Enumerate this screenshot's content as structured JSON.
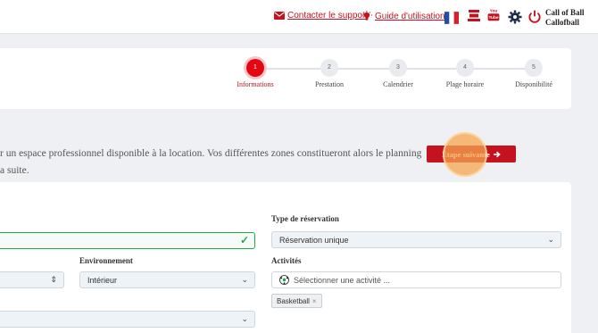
{
  "topbar": {
    "support_link": "Contacter le support",
    "guide_link": "Guide d'utilisation",
    "user": {
      "name": "Call of Ball",
      "handle": "Callofball"
    },
    "icons": [
      "envelope-icon",
      "lightbulb-icon",
      "french-flag-icon",
      "store-icon",
      "youtube-icon",
      "gear-icon",
      "power-icon"
    ],
    "colors": {
      "accent": "#c4121f"
    }
  },
  "stepper": {
    "active_index": 0,
    "steps": [
      {
        "number": "1",
        "label": "Informations"
      },
      {
        "number": "2",
        "label": "Prestation"
      },
      {
        "number": "3",
        "label": "Calendrier"
      },
      {
        "number": "4",
        "label": "Plage horaire"
      },
      {
        "number": "5",
        "label": "Disponibilité"
      }
    ]
  },
  "intro": {
    "line1": "r un espace professionnel disponible à la location. Vos différentes zones constitueront alors le planning",
    "line2": "a suite."
  },
  "next_button": {
    "label": "Étape suivante"
  },
  "form": {
    "type_reservation": {
      "label": "Type de réservation",
      "value": "Réservation unique"
    },
    "environnement": {
      "label": "Environnement",
      "value": "Intérieur"
    },
    "activites": {
      "label": "Activités",
      "placeholder": "Sélectionner une activité ...",
      "selected": [
        "Basketball"
      ]
    }
  }
}
